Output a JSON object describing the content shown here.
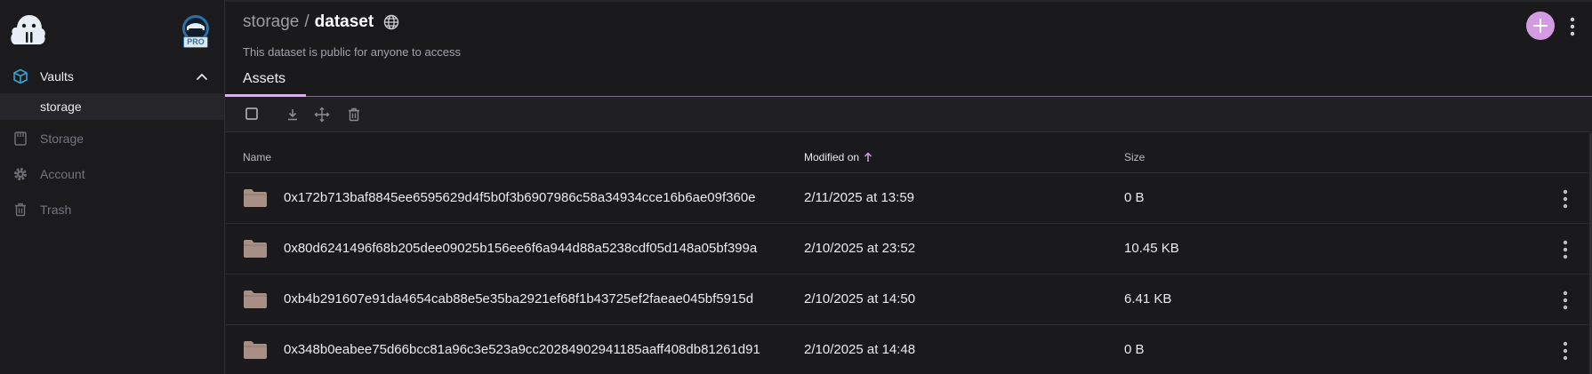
{
  "sidebar": {
    "pro_badge": "PRO",
    "vaults_label": "Vaults",
    "vault_items": [
      "storage"
    ],
    "storage_label": "Storage",
    "account_label": "Account",
    "trash_label": "Trash"
  },
  "header": {
    "breadcrumb_parent": "storage",
    "breadcrumb_sep": "/",
    "breadcrumb_current": "dataset",
    "subtitle": "This dataset is public for anyone to access"
  },
  "tabs": {
    "assets": "Assets"
  },
  "table": {
    "columns": {
      "name": "Name",
      "modified": "Modified on",
      "size": "Size"
    },
    "rows": [
      {
        "name": "0x172b713baf8845ee6595629d4f5b0f3b6907986c58a34934cce16b6ae09f360e",
        "modified": "2/11/2025 at 13:59",
        "size": "0 B"
      },
      {
        "name": "0x80d6241496f68b205dee09025b156ee6f6a944d88a5238cdf05d148a05bf399a",
        "modified": "2/10/2025 at 23:52",
        "size": "10.45 KB"
      },
      {
        "name": "0xb4b291607e91da4654cab88e5e35ba2921ef68f1b43725ef2faeae045bf5915d",
        "modified": "2/10/2025 at 14:50",
        "size": "6.41 KB"
      },
      {
        "name": "0x348b0eabee75d66bcc81a96c3e523a9cc20284902941185aaff408db81261d91",
        "modified": "2/10/2025 at 14:48",
        "size": "0 B"
      }
    ]
  },
  "colors": {
    "accent": "#d39be2",
    "vault_icon": "#3aa0d8",
    "folder": "#a88f86",
    "background": "#1a1a1d"
  },
  "icons": {
    "logo": "walrus-logo-icon",
    "avatar": "user-avatar-icon",
    "vaults": "cube-icon",
    "storage": "storage-icon",
    "account": "gear-icon",
    "trash": "trash-icon",
    "globe": "globe-icon",
    "add": "plus-icon",
    "more": "kebab-icon",
    "folder": "folder-icon"
  }
}
